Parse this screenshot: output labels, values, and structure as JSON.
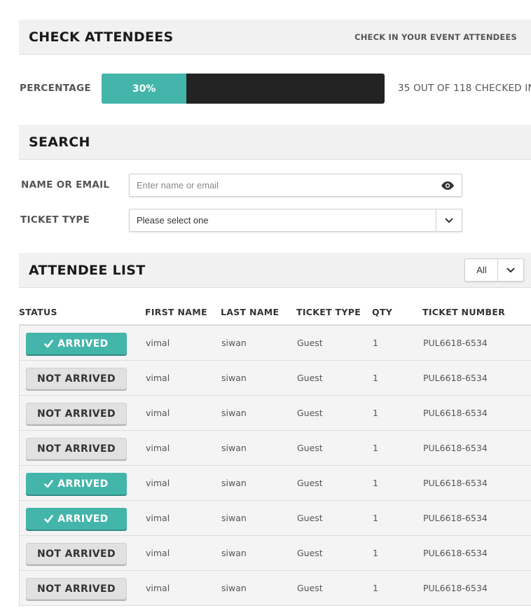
{
  "header": {
    "title": "CHECK ATTENDEES",
    "subtitle": "CHECK IN YOUR EVENT ATTENDEES"
  },
  "progress": {
    "label": "PERCENTAGE",
    "percent": 30,
    "percent_text": "30%",
    "count_text": "35 OUT OF 118 CHECKED IN",
    "fill_color": "#44b5aa",
    "track_color": "#232323"
  },
  "search": {
    "title": "SEARCH",
    "name_label": "NAME OR EMAIL",
    "name_placeholder": "Enter name or email",
    "name_value": "",
    "ticket_label": "TICKET TYPE",
    "ticket_selected": "Please select one"
  },
  "attendee_list": {
    "title": "ATTENDEE LIST",
    "filter_selected": "All",
    "columns": [
      "STATUS",
      "FIRST NAME",
      "LAST NAME",
      "TICKET TYPE",
      "QTY",
      "TICKET NUMBER"
    ],
    "rows": [
      {
        "status": "arrived",
        "status_label": "ARRIVED",
        "first_name": "vimal",
        "last_name": "siwan",
        "ticket_type": "Guest",
        "qty": "1",
        "ticket_number": "PUL6618-6534"
      },
      {
        "status": "not-arrived",
        "status_label": "NOT ARRIVED",
        "first_name": "vimal",
        "last_name": "siwan",
        "ticket_type": "Guest",
        "qty": "1",
        "ticket_number": "PUL6618-6534"
      },
      {
        "status": "not-arrived",
        "status_label": "NOT ARRIVED",
        "first_name": "vimal",
        "last_name": "siwan",
        "ticket_type": "Guest",
        "qty": "1",
        "ticket_number": "PUL6618-6534"
      },
      {
        "status": "not-arrived",
        "status_label": "NOT ARRIVED",
        "first_name": "vimal",
        "last_name": "siwan",
        "ticket_type": "Guest",
        "qty": "1",
        "ticket_number": "PUL6618-6534"
      },
      {
        "status": "arrived",
        "status_label": "ARRIVED",
        "first_name": "vimal",
        "last_name": "siwan",
        "ticket_type": "Guest",
        "qty": "1",
        "ticket_number": "PUL6618-6534"
      },
      {
        "status": "arrived",
        "status_label": "ARRIVED",
        "first_name": "vimal",
        "last_name": "siwan",
        "ticket_type": "Guest",
        "qty": "1",
        "ticket_number": "PUL6618-6534"
      },
      {
        "status": "not-arrived",
        "status_label": "NOT ARRIVED",
        "first_name": "vimal",
        "last_name": "siwan",
        "ticket_type": "Guest",
        "qty": "1",
        "ticket_number": "PUL6618-6534"
      },
      {
        "status": "not-arrived",
        "status_label": "NOT ARRIVED",
        "first_name": "vimal",
        "last_name": "siwan",
        "ticket_type": "Guest",
        "qty": "1",
        "ticket_number": "PUL6618-6534"
      }
    ]
  },
  "icons": {
    "eye": "eye-icon",
    "chevron": "chevron-down-icon",
    "check": "check-icon"
  }
}
